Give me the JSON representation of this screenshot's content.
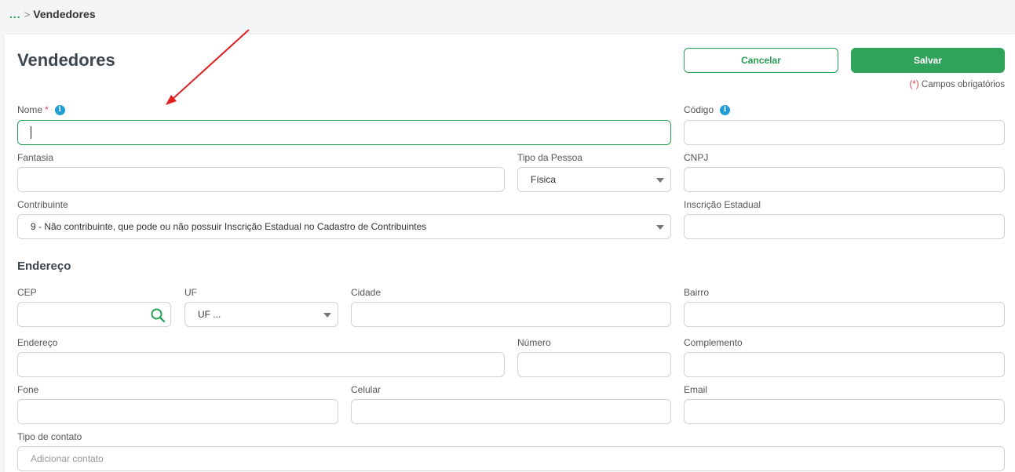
{
  "breadcrumb": {
    "ellipsis": "...",
    "separator": ">",
    "current": "Vendedores"
  },
  "page": {
    "title": "Vendedores"
  },
  "actions": {
    "cancel_label": "Cancelar",
    "save_label": "Salvar"
  },
  "required_note": {
    "asterisk": "(*)",
    "text": " Campos obrigatórios"
  },
  "form": {
    "nome": {
      "label": "Nome",
      "required": "*",
      "value": ""
    },
    "codigo": {
      "label": "Código",
      "value": ""
    },
    "fantasia": {
      "label": "Fantasia",
      "value": ""
    },
    "tipo_pessoa": {
      "label": "Tipo da Pessoa",
      "value": "Física"
    },
    "cnpj": {
      "label": "CNPJ",
      "value": ""
    },
    "contribuinte": {
      "label": "Contribuinte",
      "value": "9 - Não contribuinte, que pode ou não possuir Inscrição Estadual no Cadastro de Contribuintes"
    },
    "inscricao_estadual": {
      "label": "Inscrição Estadual",
      "value": ""
    }
  },
  "endereco_section": {
    "title": "Endereço",
    "cep": {
      "label": "CEP",
      "value": ""
    },
    "uf": {
      "label": "UF",
      "value": "UF ..."
    },
    "cidade": {
      "label": "Cidade",
      "value": ""
    },
    "bairro": {
      "label": "Bairro",
      "value": ""
    },
    "endereco": {
      "label": "Endereço",
      "value": ""
    },
    "numero": {
      "label": "Número",
      "value": ""
    },
    "complemento": {
      "label": "Complemento",
      "value": ""
    },
    "fone": {
      "label": "Fone",
      "value": ""
    },
    "celular": {
      "label": "Celular",
      "value": ""
    },
    "email": {
      "label": "Email",
      "value": ""
    },
    "tipo_contato": {
      "label": "Tipo de contato",
      "placeholder": "Adicionar contato"
    }
  },
  "icons": {
    "info": "info-icon",
    "search": "search-icon",
    "dropdown": "chevron-down-icon"
  },
  "colors": {
    "accent": "#2fa35a",
    "required": "#e0454f",
    "info": "#1f9fd6",
    "annotation": "#e02020"
  }
}
